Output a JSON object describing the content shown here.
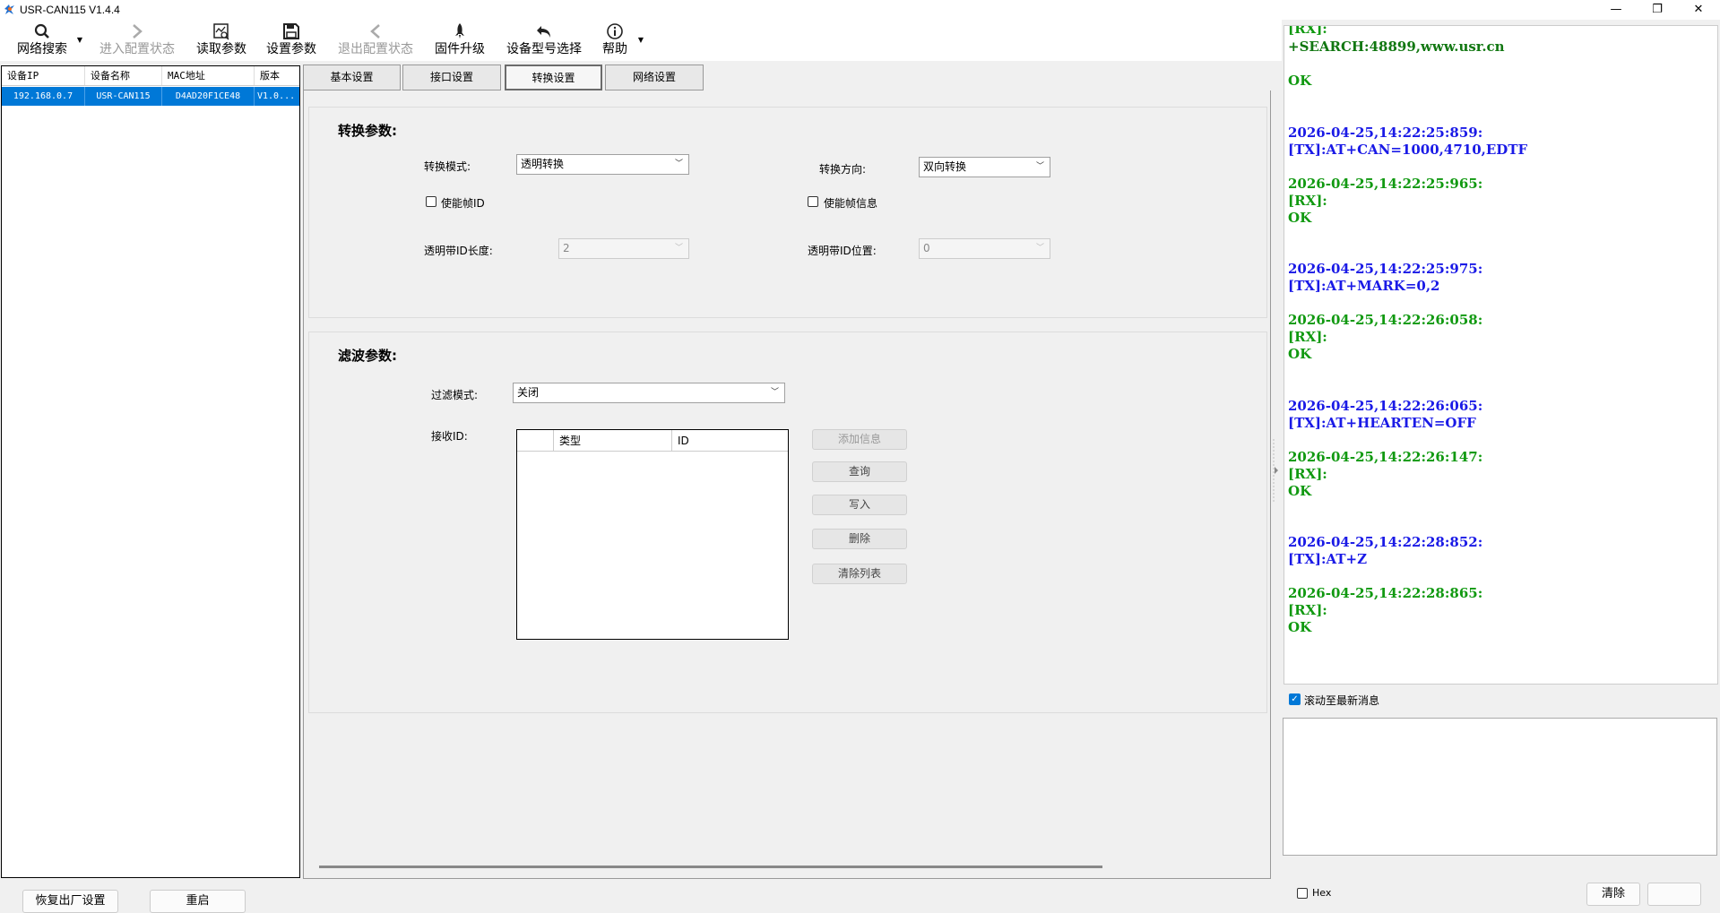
{
  "window": {
    "title": "USR-CAN115 V1.4.4",
    "minimize": "—",
    "maximize": "❐",
    "close": "✕"
  },
  "toolbar": [
    {
      "label": "网络搜索",
      "icon": "search-icon",
      "enabled": true
    },
    {
      "label": "进入配置状态",
      "icon": "chevron-right-icon",
      "enabled": false
    },
    {
      "label": "读取参数",
      "icon": "read-params-icon",
      "enabled": true
    },
    {
      "label": "设置参数",
      "icon": "save-icon",
      "enabled": true
    },
    {
      "label": "退出配置状态",
      "icon": "chevron-left-icon",
      "enabled": false
    },
    {
      "label": "固件升级",
      "icon": "rocket-icon",
      "enabled": true
    },
    {
      "label": "设备型号选择",
      "icon": "undo-arrow-icon",
      "enabled": true
    },
    {
      "label": "帮助",
      "icon": "info-icon",
      "enabled": true
    }
  ],
  "device_list": {
    "columns": [
      "设备IP",
      "设备名称",
      "MAC地址",
      "版本"
    ],
    "rows": [
      [
        "192.168.0.7",
        "USR-CAN115",
        "D4AD20F1CE48",
        "V1.0..."
      ]
    ]
  },
  "tabs": [
    "基本设置",
    "接口设置",
    "转换设置",
    "网络设置"
  ],
  "active_tab": 2,
  "conversion": {
    "title": "转换参数:",
    "mode_label": "转换模式:",
    "mode_value": "透明转换",
    "direction_label": "转换方向:",
    "direction_value": "双向转换",
    "enable_frame_id": "使能帧ID",
    "enable_frame_info": "使能帧信息",
    "id_length_label": "透明带ID长度:",
    "id_length_value": "2",
    "id_position_label": "透明带ID位置:",
    "id_position_value": "0"
  },
  "filter": {
    "title": "滤波参数:",
    "mode_label": "过滤模式:",
    "mode_value": "关闭",
    "receive_id_label": "接收ID:",
    "table_columns": [
      "类型",
      "ID"
    ],
    "buttons": {
      "add": "添加信息",
      "query": "查询",
      "write": "写入",
      "delete": "删除",
      "clear": "清除列表"
    }
  },
  "log": [
    {
      "kind": "rx",
      "text": "[RX]:"
    },
    {
      "kind": "rx-dark",
      "text": "+SEARCH:48899,www.usr.cn"
    },
    {
      "kind": "rx",
      "text": "OK"
    },
    {
      "kind": "tx",
      "text": "2026-04-25,14:22:25:859:"
    },
    {
      "kind": "tx",
      "text": "[TX]:AT+CAN=1000,4710,EDTF"
    },
    {
      "kind": "rx",
      "text": "2026-04-25,14:22:25:965:"
    },
    {
      "kind": "rx",
      "text": "[RX]:"
    },
    {
      "kind": "rx",
      "text": "OK"
    },
    {
      "kind": "tx",
      "text": "2026-04-25,14:22:25:975:"
    },
    {
      "kind": "tx",
      "text": "[TX]:AT+MARK=0,2"
    },
    {
      "kind": "rx",
      "text": "2026-04-25,14:22:26:058:"
    },
    {
      "kind": "rx",
      "text": "[RX]:"
    },
    {
      "kind": "rx",
      "text": "OK"
    },
    {
      "kind": "tx",
      "text": "2026-04-25,14:22:26:065:"
    },
    {
      "kind": "tx",
      "text": "[TX]:AT+HEARTEN=OFF"
    },
    {
      "kind": "rx",
      "text": "2026-04-25,14:22:26:147:"
    },
    {
      "kind": "rx",
      "text": "[RX]:"
    },
    {
      "kind": "rx",
      "text": "OK"
    },
    {
      "kind": "tx",
      "text": "2026-04-25,14:22:28:852:"
    },
    {
      "kind": "tx",
      "text": "[TX]:AT+Z"
    },
    {
      "kind": "rx",
      "text": "2026-04-25,14:22:28:865:"
    },
    {
      "kind": "rx",
      "text": "[RX]:"
    },
    {
      "kind": "rx",
      "text": "OK"
    }
  ],
  "scroll_latest": {
    "label": "滚动至最新消息",
    "checked": true
  },
  "hex": {
    "label": "Hex",
    "checked": false
  },
  "footer": {
    "factory_reset": "恢复出厂设置",
    "restart": "重启",
    "clear": "清除"
  },
  "colors": {
    "tx": "#1a1ae6",
    "rx": "#119911",
    "selection": "#0078d7"
  }
}
